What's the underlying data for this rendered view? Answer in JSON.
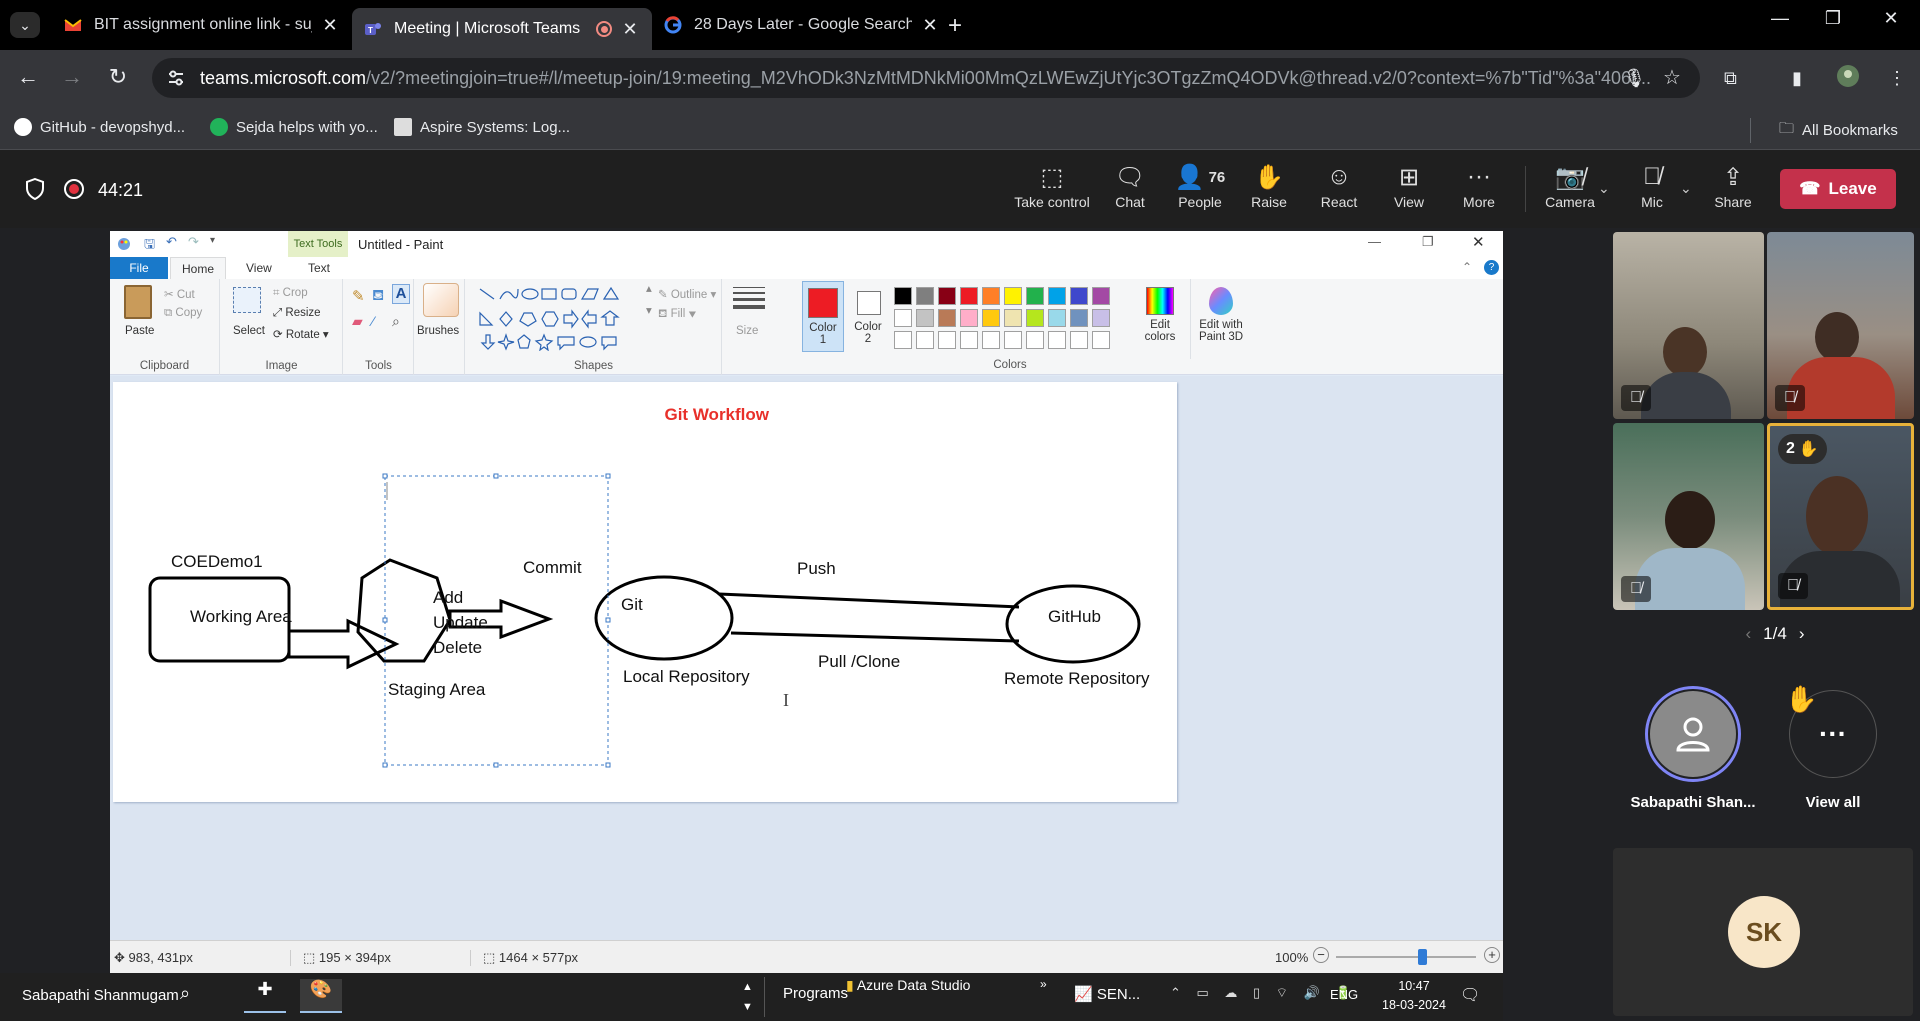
{
  "browser": {
    "tabs": [
      {
        "title": "BIT assignment online link - suj",
        "active": false
      },
      {
        "title": "Meeting | Microsoft Teams",
        "active": true
      },
      {
        "title": "28 Days Later - Google Search",
        "active": false
      }
    ],
    "url_host": "teams.microsoft.com",
    "url_path": "/v2/?meetingjoin=true#/l/meetup-join/19:meeting_M2VhODk3NzMtMDNkMi00MmQzLWEwZjUtYjc3OTgzZmQ4ODVk@thread.v2/0?context=%7b\"Tid\"%3a\"406f...",
    "bookmarks": [
      "GitHub - devopshyd...",
      "Sejda helps with yo...",
      "Aspire Systems: Log..."
    ],
    "all_bookmarks": "All Bookmarks"
  },
  "meeting": {
    "timer": "44:21",
    "controls": {
      "take_control": "Take control",
      "chat": "Chat",
      "people": "People",
      "people_count": "76",
      "raise": "Raise",
      "react": "React",
      "view": "View",
      "more": "More",
      "camera": "Camera",
      "mic": "Mic",
      "share": "Share",
      "leave": "Leave"
    },
    "raised_count": "2",
    "pager": "1/4",
    "presenter_name": "Sabapathi Shan...",
    "view_all": "View all",
    "initials": "SK"
  },
  "paint": {
    "title": "Untitled - Paint",
    "context_tab": "Text Tools",
    "tabs": [
      "File",
      "Home",
      "View",
      "Text"
    ],
    "clipboard": {
      "paste": "Paste",
      "cut": "Cut",
      "copy": "Copy",
      "label": "Clipboard"
    },
    "image": {
      "select": "Select",
      "crop": "Crop",
      "resize": "Resize",
      "rotate": "Rotate",
      "label": "Image"
    },
    "tools_label": "Tools",
    "brushes": "Brushes",
    "shapes": {
      "outline": "Outline",
      "fill": "Fill",
      "label": "Shapes"
    },
    "size": "Size",
    "color1": "Color\n1",
    "color2": "Color\n2",
    "colors_label": "Colors",
    "edit_colors": "Edit\ncolors",
    "edit_paint3d": "Edit with\nPaint 3D",
    "palette_row1": [
      "#000000",
      "#7f7f7f",
      "#880015",
      "#ed1c24",
      "#ff7f27",
      "#fff200",
      "#22b14c",
      "#00a2e8",
      "#3f48cc",
      "#a349a4"
    ],
    "palette_row2": [
      "#ffffff",
      "#c3c3c3",
      "#b97a57",
      "#ffaec9",
      "#ffc90e",
      "#efe4b0",
      "#b5e61d",
      "#99d9ea",
      "#7092be",
      "#c8bfe7"
    ],
    "color1_value": "#ed1c24",
    "status": {
      "cursor": "983, 431px",
      "selection": "195 × 394px",
      "canvas_size": "1464 × 577px",
      "zoom": "100%"
    },
    "drawing": {
      "title": "Git Workflow",
      "coe": "COEDemo1",
      "working_area": "Working Area",
      "add": "Add",
      "update": "Update",
      "delete": "Delete",
      "staging": "Staging Area",
      "commit": "Commit",
      "git": "Git",
      "local_repo": "Local Repository",
      "push": "Push",
      "pull_clone": "Pull /Clone",
      "github": "GitHub",
      "remote_repo": "Remote Repository"
    }
  },
  "taskbar": {
    "user": "Sabapathi Shanmugam",
    "programs": "Programs",
    "azure": "Azure Data Studio",
    "sen": "SEN...",
    "lang": "ENG",
    "time": "10:47",
    "date": "18-03-2024"
  },
  "colors": {
    "accent_leave": "#c4314b",
    "title_red": "#e8302a",
    "highlight_tile": "#e8b23a"
  }
}
